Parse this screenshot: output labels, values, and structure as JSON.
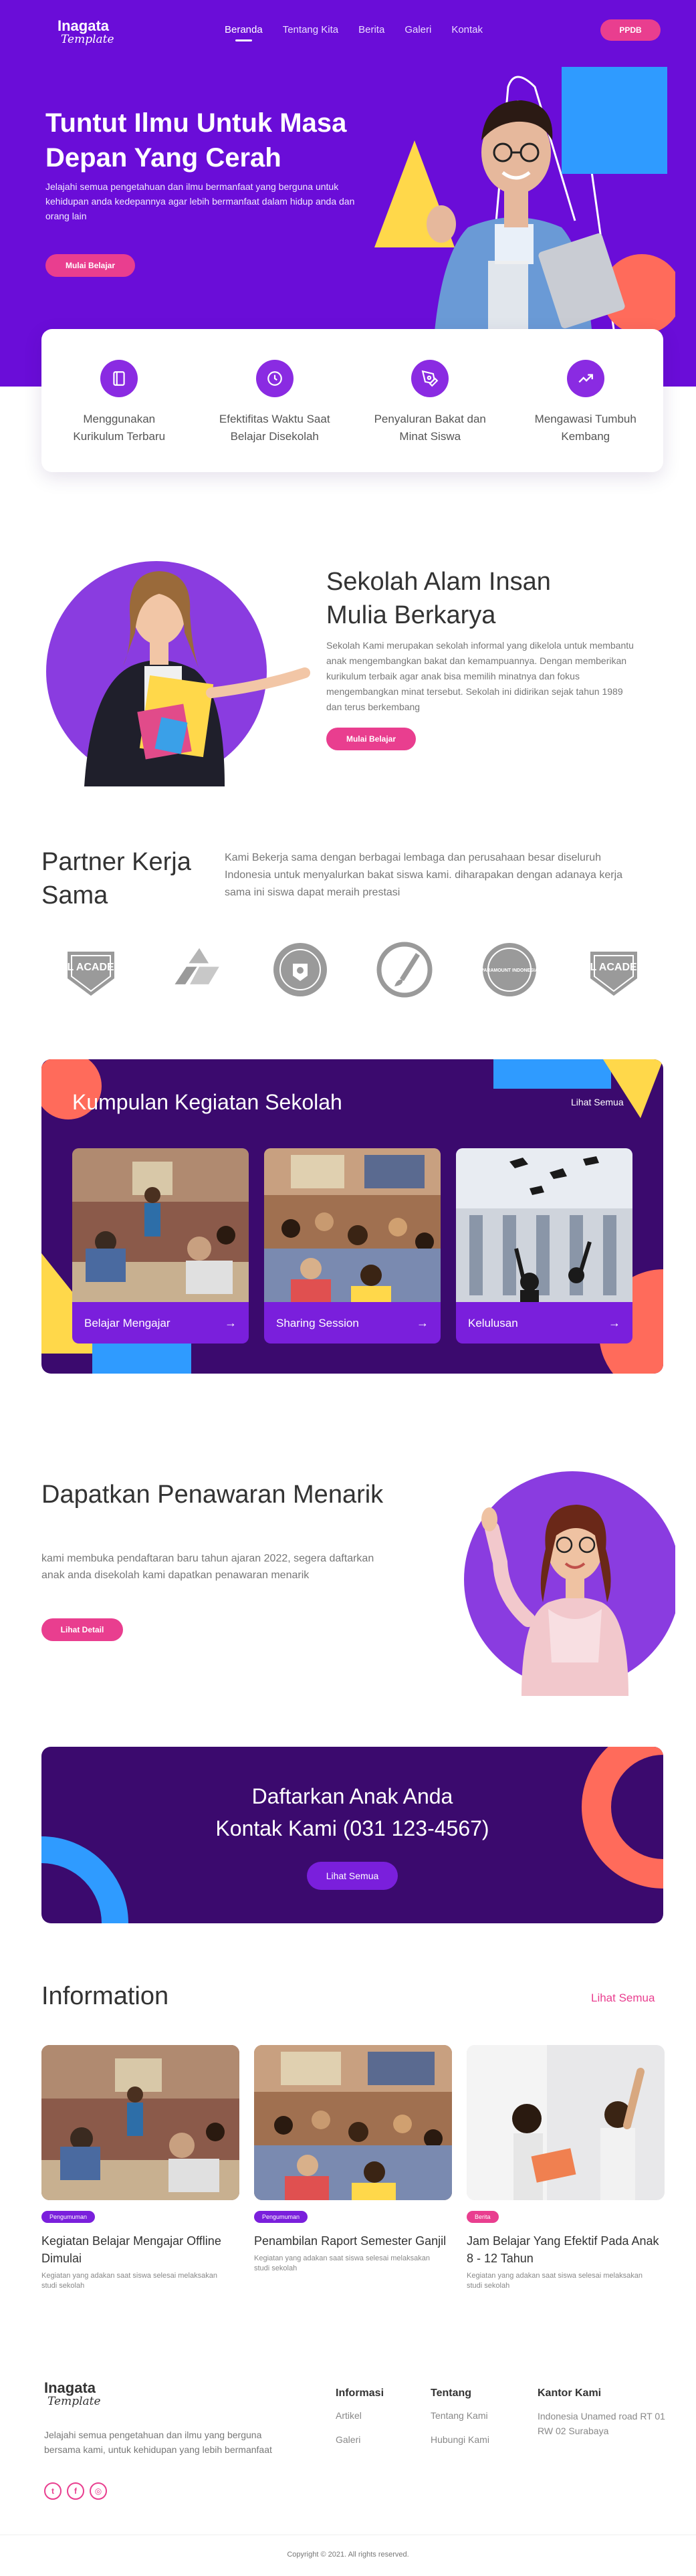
{
  "brand": {
    "name": "Inagata",
    "tagline": "Template"
  },
  "nav": {
    "items": [
      {
        "label": "Beranda",
        "active": true
      },
      {
        "label": "Tentang Kita",
        "active": false
      },
      {
        "label": "Berita",
        "active": false
      },
      {
        "label": "Galeri",
        "active": false
      },
      {
        "label": "Kontak",
        "active": false
      }
    ],
    "ppdb_label": "PPDB"
  },
  "hero": {
    "title": "Tuntut Ilmu Untuk Masa Depan Yang Cerah",
    "description": "Jelajahi  semua pengetahuan dan ilmu bermanfaat yang berguna untuk kehidupan anda kedepannya agar lebih bermanfaat dalam hidup anda dan orang lain",
    "cta": "Mulai Belajar"
  },
  "features": [
    {
      "icon": "book-icon",
      "label": "Menggunakan Kurikulum Terbaru"
    },
    {
      "icon": "clock-icon",
      "label": "Efektifitas Waktu Saat Belajar Disekolah"
    },
    {
      "icon": "pen-tool-icon",
      "label": "Penyaluran Bakat dan Minat Siswa"
    },
    {
      "icon": "trending-up-icon",
      "label": "Mengawasi Tumbuh Kembang"
    }
  ],
  "about": {
    "title": "Sekolah Alam Insan Mulia Berkarya",
    "description": "Sekolah Kami merupakan sekolah informal yang dikelola untuk membantu anak mengembangkan bakat dan kemampuannya. Dengan memberikan kurikulum terbaik agar anak bisa memilih minatnya dan fokus mengembangkan minat tersebut. Sekolah ini didirikan sejak tahun 1989 dan terus berkembang",
    "cta": "Mulai Belajar"
  },
  "partners": {
    "title": "Partner Kerja Sama",
    "description": "Kami Bekerja sama dengan berbagai lembaga dan perusahaan besar diseluruh Indonesia untuk menyalurkan bakat siswa kami. diharapakan dengan adanaya kerja sama ini siswa dapat meraih prestasi",
    "logos": [
      "DBL ACADEMY",
      "pertamina-logo",
      "emblem-logo",
      "brush-logo",
      "PARAMOUNT INDONESIA",
      "DBL ACADEMY"
    ]
  },
  "activities": {
    "title": "Kumpulan Kegiatan Sekolah",
    "see_all": "Lihat Semua",
    "items": [
      {
        "label": "Belajar Mengajar"
      },
      {
        "label": "Sharing Session"
      },
      {
        "label": "Kelulusan"
      }
    ]
  },
  "offer": {
    "title": "Dapatkan Penawaran Menarik",
    "description": "kami membuka pendaftaran baru tahun ajaran 2022, segera daftarkan anak anda disekolah kami dapatkan penawaran menarik",
    "cta": "Lihat Detail"
  },
  "contact_banner": {
    "line1": "Daftarkan Anak Anda",
    "line2": "Kontak Kami (031 123-4567)",
    "cta": "Lihat Semua"
  },
  "information": {
    "title": "Information",
    "see_all": "Lihat Semua",
    "items": [
      {
        "badge": "Pengumuman",
        "badge_color": "#7a1fdc",
        "title": "Kegiatan Belajar Mengajar Offline Dimulai",
        "excerpt": "Kegiatan yang adakan saat siswa selesai melaksakan studi sekolah"
      },
      {
        "badge": "Pengumuman",
        "badge_color": "#7a1fdc",
        "title": "Penambilan Raport Semester Ganjil",
        "excerpt": "Kegiatan yang adakan saat siswa selesai melaksakan studi sekolah"
      },
      {
        "badge": "Berita",
        "badge_color": "#e93e8f",
        "title": "Jam Belajar Yang Efektif Pada Anak 8 - 12 Tahun",
        "excerpt": "Kegiatan yang adakan saat siswa selesai melaksakan studi sekolah"
      }
    ]
  },
  "footer": {
    "description": "Jelajahi semua pengetahuan dan ilmu yang berguna bersama kami, untuk kehidupan yang lebih bermanfaat",
    "socials": [
      "twitter-icon",
      "facebook-icon",
      "instagram-icon"
    ],
    "columns": [
      {
        "title": "Informasi",
        "links": [
          "Artikel",
          "Galeri"
        ]
      },
      {
        "title": "Tentang",
        "links": [
          "Tentang Kami",
          "Hubungi Kami"
        ]
      },
      {
        "title": "Kantor Kami",
        "address": "Indonesia Unamed road RT 01 RW 02 Surabaya"
      }
    ],
    "copyright": "Copyright © 2021. All rights reserved."
  },
  "colors": {
    "primary": "#6a0dd8",
    "dark": "#3b0a6e",
    "accent": "#e93e8f",
    "yellow": "#ffd84a",
    "blue": "#2f9bff",
    "coral": "#ff6b5b"
  }
}
